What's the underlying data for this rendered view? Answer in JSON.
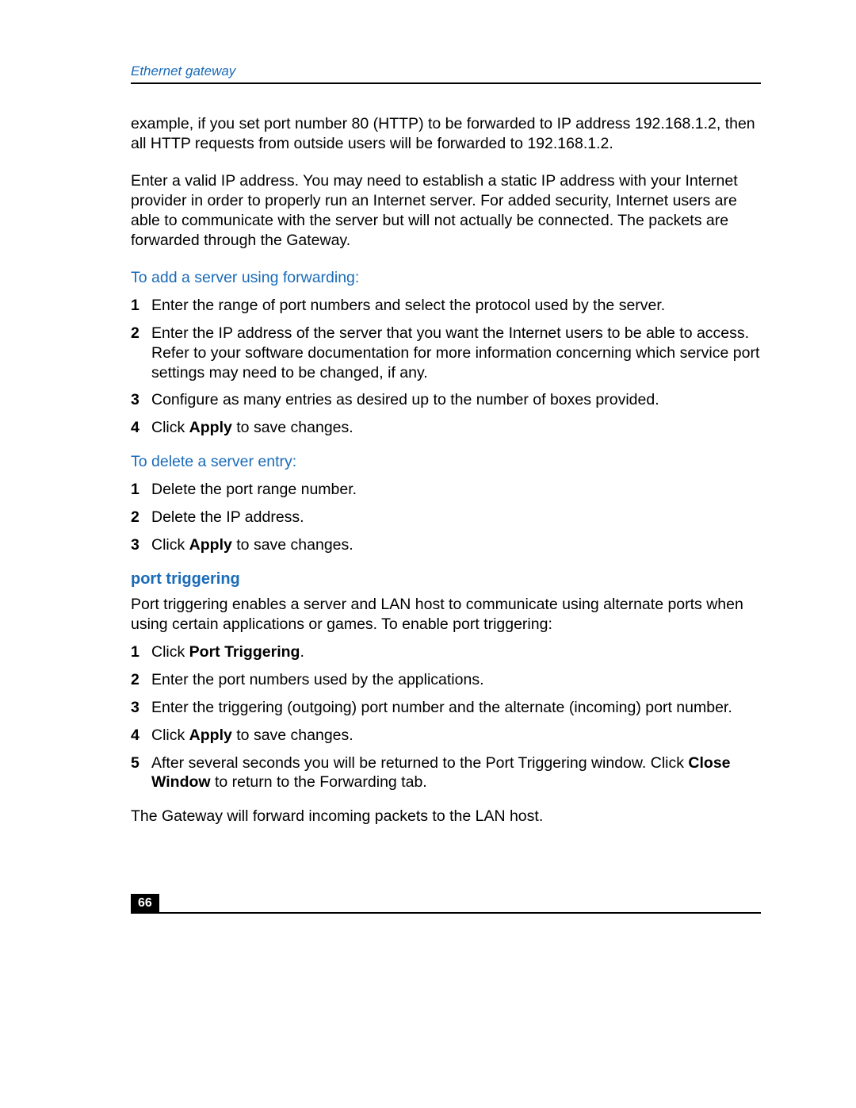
{
  "header": {
    "title": "Ethernet gateway"
  },
  "intro": {
    "p1": "example, if you set port number 80 (HTTP) to be forwarded to IP address 192.168.1.2, then all HTTP requests from outside users will be forwarded to 192.168.1.2.",
    "p2": "Enter a valid IP address. You may need to establish a static IP address with your Internet provider in order to properly run an Internet server. For added security, Internet users are able to communicate with the server but will not actually be connected. The packets are forwarded through the Gateway."
  },
  "add_server": {
    "heading": "To add a server using forwarding:",
    "steps": [
      {
        "n": "1",
        "text": "Enter the range of port numbers and select the protocol used by the server."
      },
      {
        "n": "2",
        "text": "Enter the IP address of the server that you want the Internet users to be able to access. Refer to your software documentation for more information concerning which service port settings may need to be changed, if any."
      },
      {
        "n": "3",
        "text": "Configure as many entries as desired up to the number of boxes provided."
      },
      {
        "n": "4",
        "pre": "Click ",
        "bold": "Apply",
        "post": " to save changes."
      }
    ]
  },
  "delete_server": {
    "heading": "To delete a server entry:",
    "steps": [
      {
        "n": "1",
        "text": "Delete the port range number."
      },
      {
        "n": "2",
        "text": "Delete the IP address."
      },
      {
        "n": "3",
        "pre": "Click ",
        "bold": "Apply",
        "post": " to save changes."
      }
    ]
  },
  "port_triggering": {
    "heading": "port triggering",
    "intro": "Port triggering enables a server and LAN host to communicate using alternate ports when using certain applications or games. To enable port triggering:",
    "steps": [
      {
        "n": "1",
        "pre": "Click ",
        "bold": "Port Triggering",
        "post": "."
      },
      {
        "n": "2",
        "text": "Enter the port numbers used by the applications."
      },
      {
        "n": "3",
        "text": "Enter the triggering (outgoing) port number and the alternate (incoming) port number."
      },
      {
        "n": "4",
        "pre": "Click ",
        "bold": "Apply",
        "post": " to save changes."
      },
      {
        "n": "5",
        "pre": "After several seconds you will be returned to the Port Triggering window. Click ",
        "bold": "Close Window",
        "post": " to return to the Forwarding tab."
      }
    ],
    "outro": "The Gateway will forward incoming packets to the LAN host."
  },
  "footer": {
    "page": "66"
  }
}
